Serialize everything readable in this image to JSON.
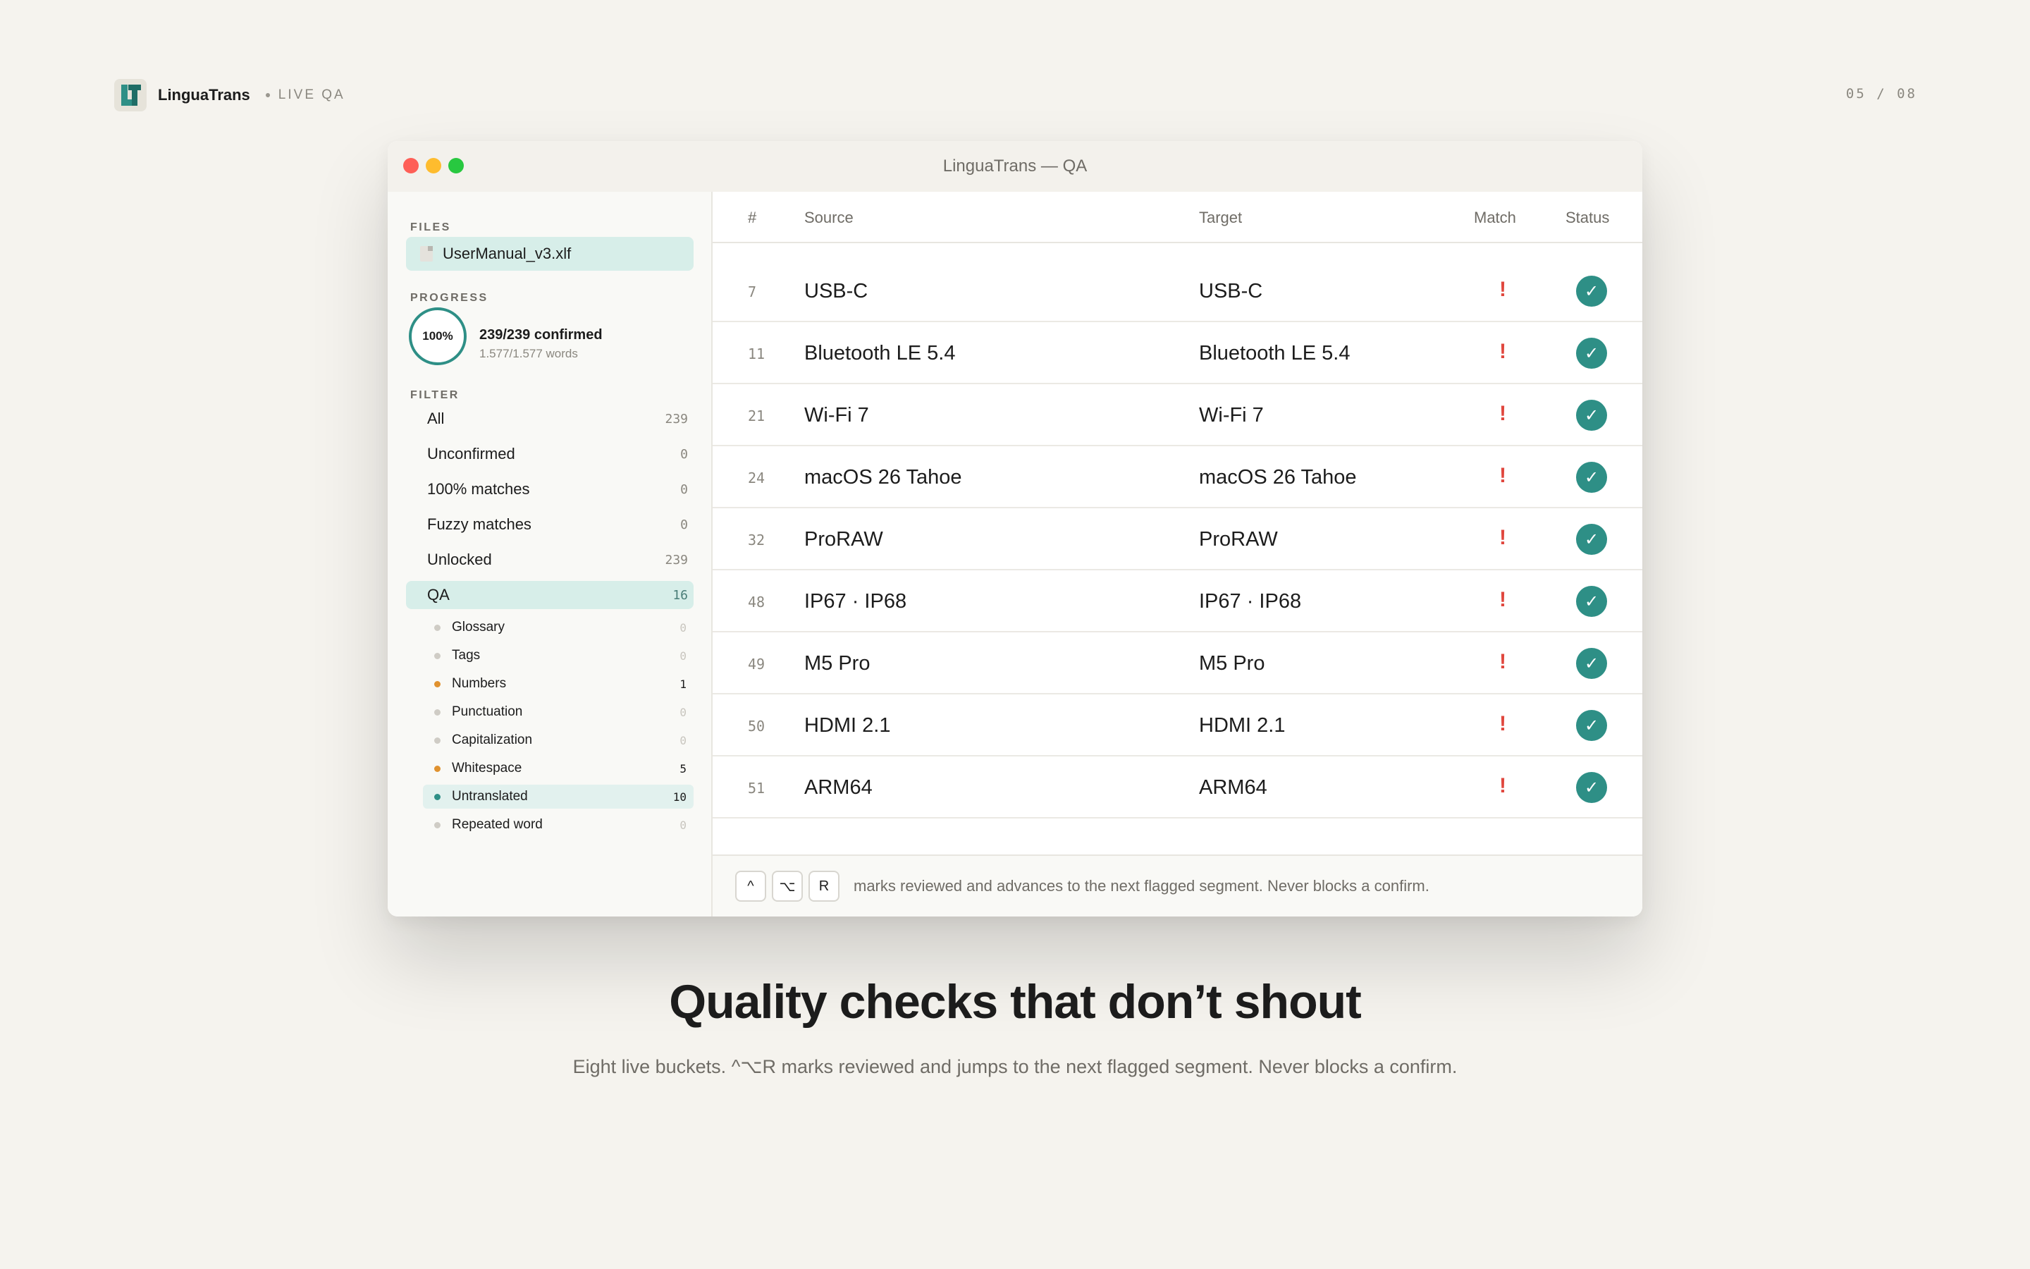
{
  "brand": {
    "name": "LinguaTrans",
    "subtitle": "LIVE QA",
    "pager": "05 / 08"
  },
  "window": {
    "title": "LinguaTrans — QA"
  },
  "sidebar": {
    "files_label": "FILES",
    "file_name": "UserManual_v3.xlf",
    "progress_label": "PROGRESS",
    "progress_percent": "100%",
    "progress_confirmed": "239/239 confirmed",
    "progress_words": "1.577/1.577 words",
    "filter_label": "FILTER",
    "filters": [
      {
        "label": "All",
        "count": "239"
      },
      {
        "label": "Unconfirmed",
        "count": "0"
      },
      {
        "label": "100% matches",
        "count": "0"
      },
      {
        "label": "Fuzzy matches",
        "count": "0"
      },
      {
        "label": "Unlocked",
        "count": "239"
      },
      {
        "label": "QA",
        "count": "16"
      }
    ],
    "qa_buckets": [
      {
        "label": "Glossary",
        "count": "0"
      },
      {
        "label": "Tags",
        "count": "0"
      },
      {
        "label": "Numbers",
        "count": "1"
      },
      {
        "label": "Punctuation",
        "count": "0"
      },
      {
        "label": "Capitalization",
        "count": "0"
      },
      {
        "label": "Whitespace",
        "count": "5"
      },
      {
        "label": "Untranslated",
        "count": "10"
      },
      {
        "label": "Repeated word",
        "count": "0"
      }
    ]
  },
  "table": {
    "headers": {
      "num": "#",
      "source": "Source",
      "target": "Target",
      "match": "Match",
      "status": "Status"
    },
    "rows": [
      {
        "num": "7",
        "source": "USB-C",
        "target": "USB-C",
        "match": "!",
        "status": "✓"
      },
      {
        "num": "11",
        "source": "Bluetooth LE 5.4",
        "target": "Bluetooth LE 5.4",
        "match": "!",
        "status": "✓"
      },
      {
        "num": "21",
        "source": "Wi-Fi 7",
        "target": "Wi-Fi 7",
        "match": "!",
        "status": "✓"
      },
      {
        "num": "24",
        "source": "macOS 26 Tahoe",
        "target": "macOS 26 Tahoe",
        "match": "!",
        "status": "✓"
      },
      {
        "num": "32",
        "source": "ProRAW",
        "target": "ProRAW",
        "match": "!",
        "status": "✓"
      },
      {
        "num": "48",
        "source": "IP67 · IP68",
        "target": "IP67 · IP68",
        "match": "!",
        "status": "✓"
      },
      {
        "num": "49",
        "source": "M5 Pro",
        "target": "M5 Pro",
        "match": "!",
        "status": "✓"
      },
      {
        "num": "50",
        "source": "HDMI 2.1",
        "target": "HDMI 2.1",
        "match": "!",
        "status": "✓"
      },
      {
        "num": "51",
        "source": "ARM64",
        "target": "ARM64",
        "match": "!",
        "status": "✓"
      }
    ]
  },
  "footer": {
    "keys": [
      "^",
      "⌥",
      "R"
    ],
    "text": "marks reviewed and advances to the next flagged segment. Never blocks a confirm."
  },
  "headline": "Quality checks that don’t shout",
  "subline": "Eight live buckets. ^⌥R marks reviewed and jumps to the next flagged segment. Never blocks a confirm.",
  "colors": {
    "accent": "#2e8f86",
    "warning": "#e0473e",
    "bucket_warn": "#e0922f",
    "background": "#f5f3ee"
  }
}
